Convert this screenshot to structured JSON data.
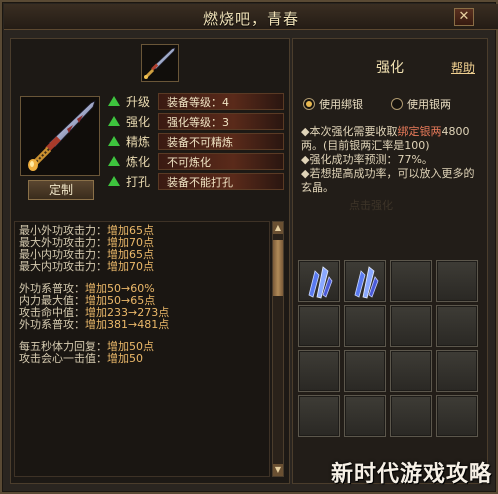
{
  "window": {
    "title": "燃烧吧，青春",
    "close": "✕"
  },
  "left": {
    "custom_button": "定制",
    "stats": [
      {
        "label": "升级",
        "value": "装备等级：4"
      },
      {
        "label": "强化",
        "value": "强化等级：3"
      },
      {
        "label": "精炼",
        "value": "装备不可精炼"
      },
      {
        "label": "炼化",
        "value": "不可炼化"
      },
      {
        "label": "打孔",
        "value": "装备不能打孔"
      }
    ],
    "info": {
      "group1": [
        {
          "k": "最小外功攻击力：",
          "v": "增加65点"
        },
        {
          "k": "最大外功攻击力：",
          "v": "增加70点"
        },
        {
          "k": "最小内功攻击力：",
          "v": "增加65点"
        },
        {
          "k": "最大内功攻击力：",
          "v": "增加70点"
        }
      ],
      "group2": [
        {
          "k": "外功系普攻：",
          "v": "增加50→60%"
        },
        {
          "k": "内力最大值：",
          "v": "增加50→65点"
        },
        {
          "k": "攻击命中值：",
          "v": "增加233→273点"
        },
        {
          "k": "外功系普攻：",
          "v": "增加381→481点"
        }
      ],
      "group3": [
        {
          "k": "每五秒体力回复：",
          "v": "增加50点"
        },
        {
          "k": "攻击会心一击值：",
          "v": "增加50"
        }
      ]
    }
  },
  "right": {
    "title": "强化",
    "help": "帮助",
    "radio_bound": "使用绑银",
    "radio_silver": "使用银两",
    "desc1_a": "◆本次强化需要收取",
    "desc1_b": "绑定银两",
    "desc1_c": "4800两。(目前银两汇率是100)",
    "desc2": "◆强化成功率预测：77%。",
    "desc3": "◆若想提高成功率，可以放入更多的玄晶。",
    "faint": "点击强化"
  },
  "watermark": "新时代游戏攻略",
  "colors": {
    "accent": "#e8b850",
    "positive": "#3ec43e",
    "value": "#ecb96a"
  }
}
